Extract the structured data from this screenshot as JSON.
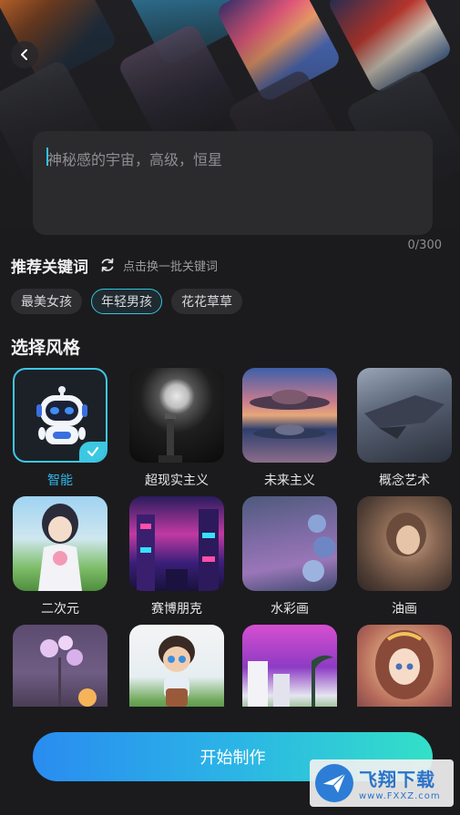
{
  "prompt": {
    "placeholder": "神秘感的宇宙，高级，恒星",
    "counter": "0/300"
  },
  "keywords": {
    "title": "推荐关键词",
    "refresh_label": "点击换一批关键词",
    "chips": [
      {
        "label": "最美女孩",
        "active": false
      },
      {
        "label": "年轻男孩",
        "active": true
      },
      {
        "label": "花花草草",
        "active": false
      }
    ]
  },
  "styles": {
    "title": "选择风格",
    "items": [
      {
        "label": "智能",
        "selected": true
      },
      {
        "label": "超现实主义"
      },
      {
        "label": "未来主义"
      },
      {
        "label": "概念艺术"
      },
      {
        "label": "二次元"
      },
      {
        "label": "赛博朋克"
      },
      {
        "label": "水彩画"
      },
      {
        "label": "油画"
      },
      {
        "label": ""
      },
      {
        "label": ""
      },
      {
        "label": ""
      },
      {
        "label": ""
      }
    ]
  },
  "actions": {
    "start_label": "开始制作"
  },
  "watermark": {
    "title": "飞翔下载",
    "url": "www.FXXZ.com"
  },
  "colors": {
    "accent": "#34c4de",
    "selected_label": "#2fb6e8",
    "button_start": "#2a8cf0",
    "button_end": "#33e0c8",
    "background": "#1b1b1d"
  }
}
